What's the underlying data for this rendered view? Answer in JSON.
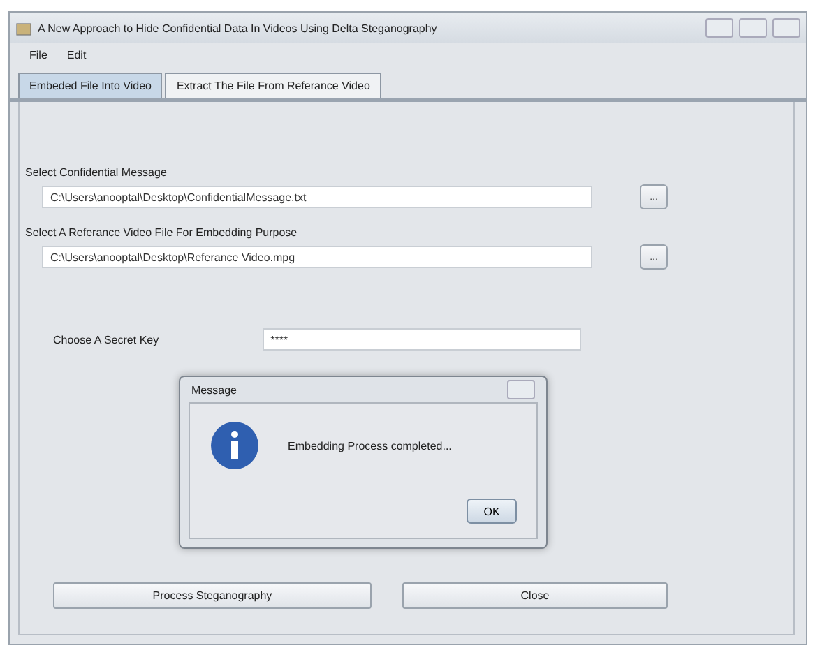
{
  "window": {
    "title": "A New Approach to Hide Confidential Data In Videos Using Delta Steganography"
  },
  "menu": [
    "File",
    "Edit"
  ],
  "tabs": [
    {
      "label": "Embeded File Into Video",
      "selected": true
    },
    {
      "label": "Extract The File From Referance Video",
      "selected": false
    }
  ],
  "fields": [
    {
      "label": "Select Confidential Message",
      "value": "C:\\Users\\anooptal\\Desktop\\ConfidentialMessage.txt",
      "browse": "..."
    },
    {
      "label": "Select A Referance Video File For Embedding Purpose",
      "value": "C:\\Users\\anooptal\\Desktop\\Referance Video.mpg",
      "browse": "..."
    }
  ],
  "secret_key": {
    "label": "Choose A Secret Key",
    "value": "****"
  },
  "buttons": [
    "Process Steganography",
    "Close"
  ],
  "dialog": {
    "title": "Message",
    "message": "Embedding Process completed...",
    "ok": "OK"
  }
}
